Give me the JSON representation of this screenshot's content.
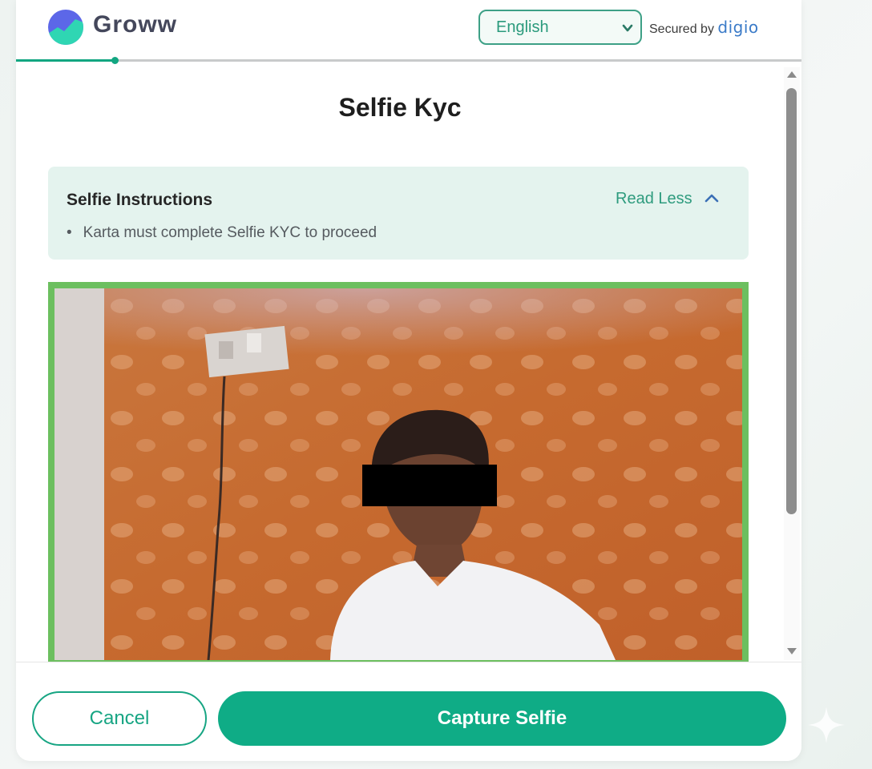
{
  "header": {
    "brand": "Groww",
    "language_selected": "English",
    "secured_by_label": "Secured by",
    "secured_by_brand": "digio",
    "progress": 0.125
  },
  "page": {
    "title": "Selfie Kyc"
  },
  "instructions": {
    "title": "Selfie Instructions",
    "toggle_label": "Read Less",
    "items": [
      "Karta must complete Selfie KYC to proceed"
    ]
  },
  "footer": {
    "cancel_label": "Cancel",
    "capture_label": "Capture Selfie"
  },
  "colors": {
    "accent": "#0fac86",
    "camera_border": "#6cbf5f",
    "instructions_bg": "#e4f3ee",
    "digio_blue": "#3b7bc8"
  },
  "icons": [
    "groww-logo-icon",
    "chevron-down-icon",
    "chevron-up-icon",
    "scroll-up-arrow-icon",
    "scroll-down-arrow-icon",
    "sparkle-icon"
  ]
}
